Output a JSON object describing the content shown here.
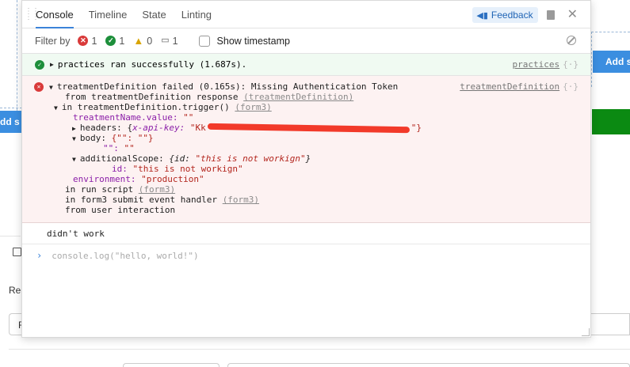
{
  "background": {
    "add_button_right": "Add s",
    "add_button_left": "dd s",
    "label_re": "Re",
    "input_partial": "F"
  },
  "tabs": [
    "Console",
    "Timeline",
    "State",
    "Linting"
  ],
  "header": {
    "feedback_label": "Feedback"
  },
  "filter": {
    "label": "Filter by",
    "error_count": "1",
    "success_count": "1",
    "warning_count": "0",
    "log_count": "1",
    "timestamp_label": "Show timestamp",
    "timestamp_checked": false
  },
  "logs": {
    "success": {
      "message": "practices ran successfully (1.687s).",
      "source": "practices"
    },
    "error": {
      "message": "treatmentDefinition failed (0.165s): Missing Authentication Token",
      "source": "treatmentDefinition",
      "from_response_prefix": "from treatmentDefinition response ",
      "from_response_link": "(treatmentDefinition)",
      "trigger_prefix": "in treatmentDefinition.trigger() ",
      "trigger_link": "(form3)",
      "treatment_name_key": "treatmentName.value:",
      "treatment_name_value": "\"\"",
      "headers_key": "headers:",
      "headers_open": "{",
      "headers_inner_key": "x-api-key:",
      "headers_value_start": "\"Kk",
      "headers_value_end": "\"}",
      "body_key": "body:",
      "body_value": "{\"\": \"\"}",
      "body_entry_key": "\"\":",
      "body_entry_value": "\"\"",
      "additional_key": "additionalScope:",
      "additional_value_prefix": "{id: ",
      "additional_value_string": "\"this is not workign\"",
      "additional_value_suffix": "}",
      "id_key": "id:",
      "id_value": "\"this is not workign\"",
      "environment_key": "environment:",
      "environment_value": "\"production\"",
      "run_script_prefix": "in run script ",
      "run_script_link": "(form3)",
      "submit_prefix": "in form3 submit event handler ",
      "submit_link": "(form3)",
      "user_interaction": "from user interaction"
    },
    "plain": "didn't work"
  },
  "input": {
    "placeholder": "console.log(\"hello, world!\")"
  }
}
